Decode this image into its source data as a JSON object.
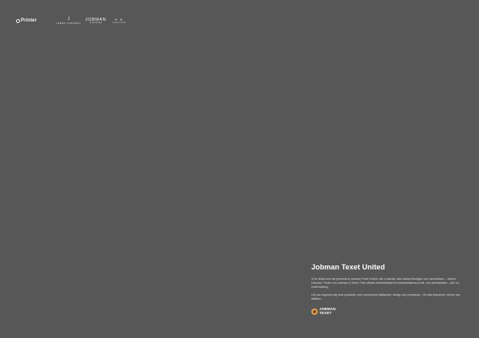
{
  "header": {
    "logos": [
      {
        "name": "Printer",
        "sub": ""
      },
      {
        "name": "J",
        "sub": "JAMES HARVEST"
      },
      {
        "name": "JOBMAN",
        "sub": "WORKWEAR"
      },
      {
        "name": "✕ ✕",
        "sub": "LINDSTRÖM"
      }
    ]
  },
  "info": {
    "title": "Jobman Texet United",
    "paragraph1": "Vi är stolta över att presentera Jobman Texet United, där vi samlar våra starka förmågor och varumärken – James Harvest, Printer och Jobman & Texet. Från effektiv arbetsklädsel till individualiserad profil- och arbetskläder – allt i en enda katalog.",
    "paragraph2": "Låt oss inspirera dig med produkter som kombinerar hållbarhet, design och prestanda – för alla branscher, behov och tillfällen."
  },
  "brand": {
    "line1": "JOBMAN",
    "line2": "TEXET",
    "accent": "#e6a23c"
  }
}
